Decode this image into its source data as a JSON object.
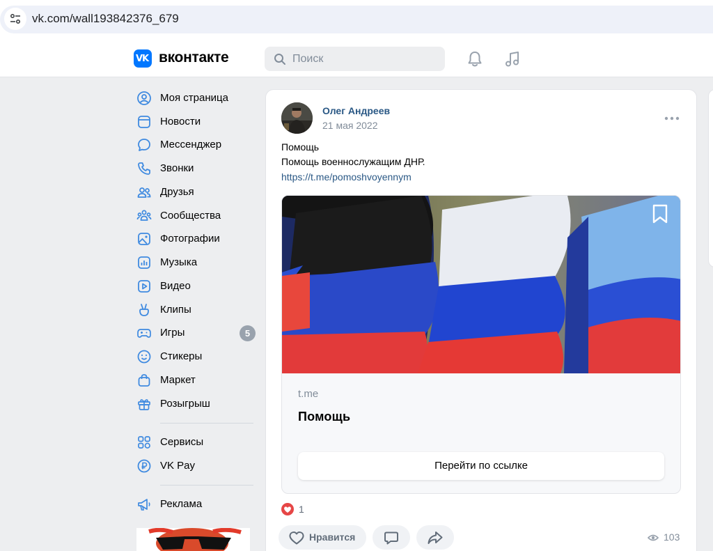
{
  "browser": {
    "url": "vk.com/wall193842376_679"
  },
  "header": {
    "logo_letters": "VK",
    "brand": "вконтакте",
    "search_placeholder": "Поиск",
    "icons": [
      "bell-icon",
      "music-icon"
    ]
  },
  "sidebar": {
    "items": [
      {
        "label": "Моя страница",
        "icon": "user-icon"
      },
      {
        "label": "Новости",
        "icon": "news-icon"
      },
      {
        "label": "Мессенджер",
        "icon": "messenger-icon"
      },
      {
        "label": "Звонки",
        "icon": "phone-icon"
      },
      {
        "label": "Друзья",
        "icon": "friends-icon"
      },
      {
        "label": "Сообщества",
        "icon": "communities-icon"
      },
      {
        "label": "Фотографии",
        "icon": "photos-icon"
      },
      {
        "label": "Музыка",
        "icon": "music-icon"
      },
      {
        "label": "Видео",
        "icon": "video-icon"
      },
      {
        "label": "Клипы",
        "icon": "clips-icon"
      },
      {
        "label": "Игры",
        "icon": "games-icon",
        "badge": "5"
      },
      {
        "label": "Стикеры",
        "icon": "stickers-icon"
      },
      {
        "label": "Маркет",
        "icon": "market-icon"
      },
      {
        "label": "Розыгрыш",
        "icon": "gift-icon"
      },
      {
        "label": "Сервисы",
        "icon": "services-icon"
      },
      {
        "label": "VK Pay",
        "icon": "vkpay-icon"
      },
      {
        "label": "Реклама",
        "icon": "ads-icon"
      }
    ]
  },
  "post": {
    "author": "Олег Андреев",
    "date": "21 мая 2022",
    "text_line1": "Помощь",
    "text_line2": "Помощь военнослужащим ДНР.",
    "link": "https://t.me/pomoshvoyennym",
    "attachment": {
      "domain": "t.me",
      "title": "Помощь",
      "button": "Перейти по ссылке"
    },
    "reactions_count": "1",
    "like_label": "Нравится",
    "views": "103"
  },
  "colors": {
    "accent": "#0077ff",
    "link": "#2a5885",
    "background": "#edeef0",
    "heart": "#e64646"
  }
}
